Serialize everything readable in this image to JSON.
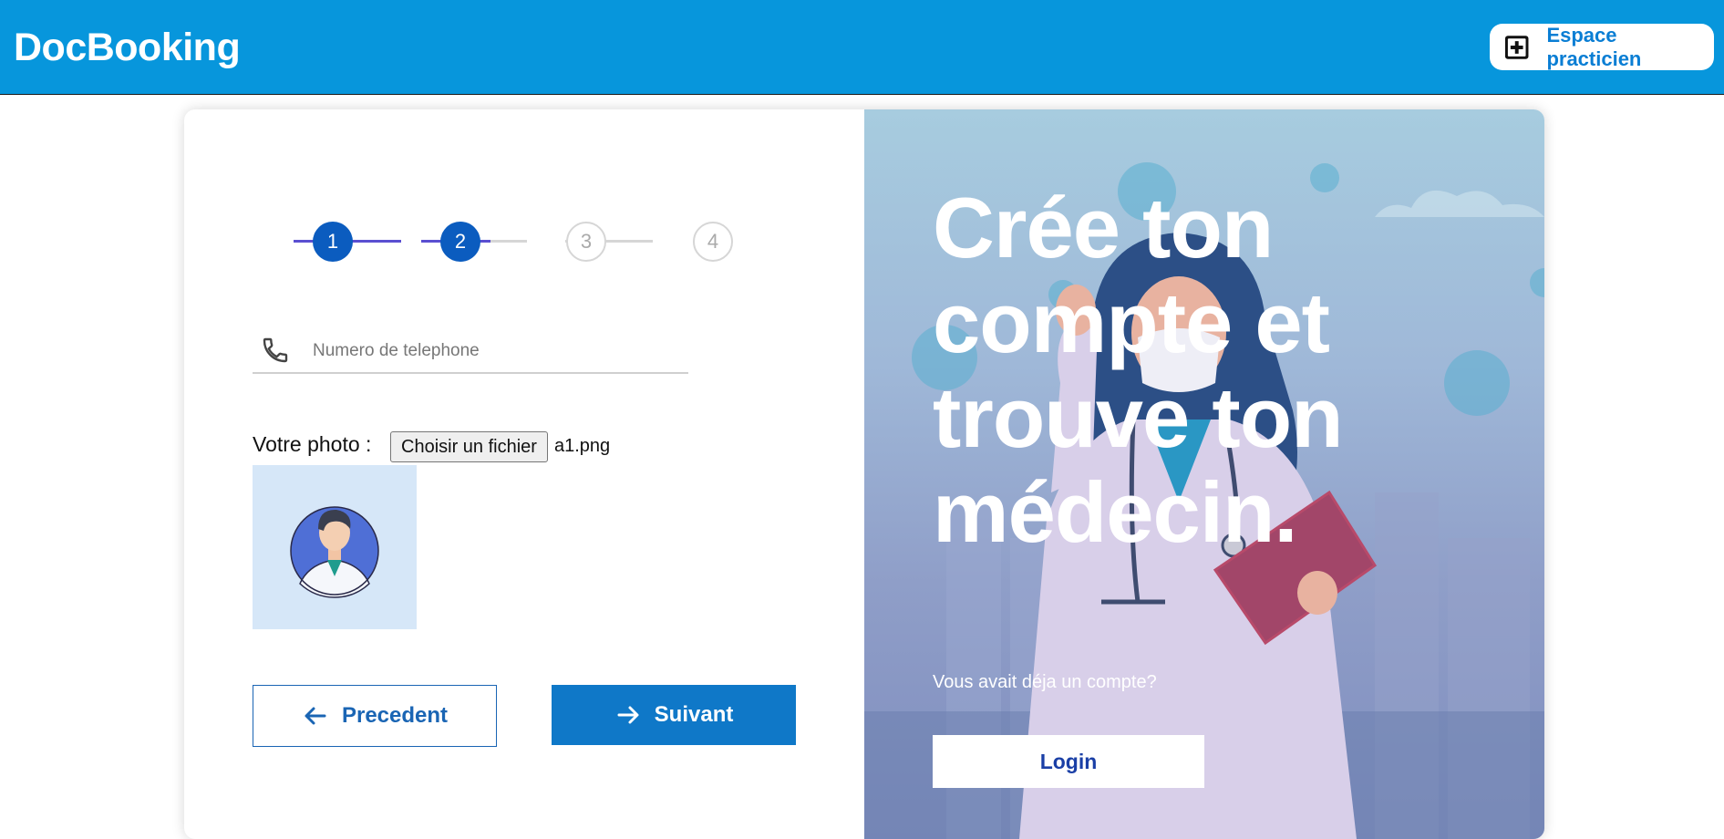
{
  "header": {
    "brand": "DocBooking",
    "pro_button_label": "Espace practicien",
    "pro_button_icon": "plus-square-icon"
  },
  "stepper": {
    "steps": [
      {
        "label": "1",
        "state": "done"
      },
      {
        "label": "2",
        "state": "done"
      },
      {
        "label": "3",
        "state": "todo"
      },
      {
        "label": "4",
        "state": "todo"
      }
    ],
    "progress_color": "#5b4fd1",
    "done_color": "#0b5cbf"
  },
  "form": {
    "phone_placeholder": "Numero de telephone",
    "phone_value": "",
    "phone_icon": "phone-icon",
    "photo_label": "Votre photo :",
    "file_button_label": "Choisir un fichier",
    "file_name": "a1.png"
  },
  "actions": {
    "prev_label": "Precedent",
    "next_label": "Suivant"
  },
  "promo": {
    "headline": "Crée ton compte et trouve ton médecin.",
    "already_text": "Vous avait déja un compte?",
    "login_label": "Login"
  },
  "colors": {
    "header_bg": "#0796dc",
    "primary": "#0f78c8",
    "login_text": "#1a3fa6"
  }
}
